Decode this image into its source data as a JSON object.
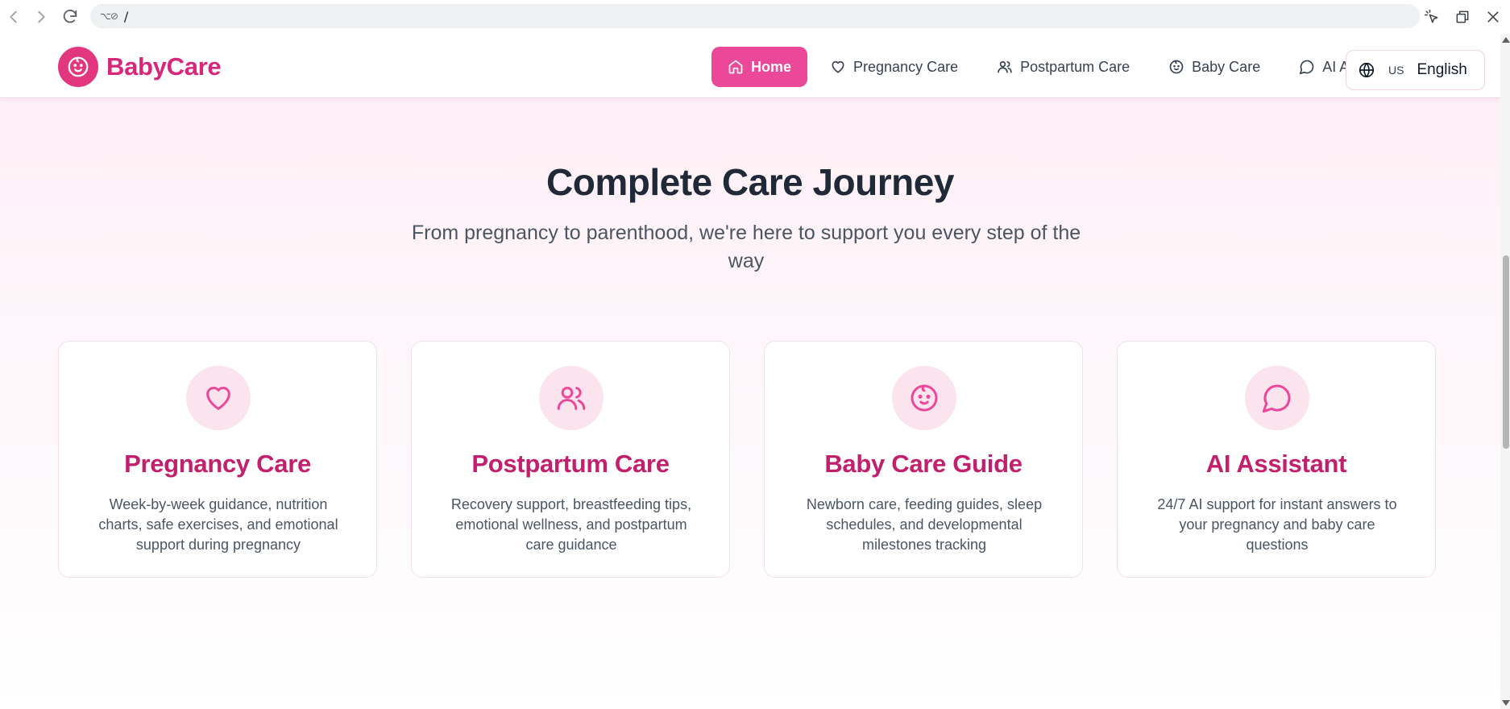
{
  "browser": {
    "url": "/",
    "back_icon": "chevron-left-icon",
    "forward_icon": "chevron-right-icon",
    "reload_icon": "reload-icon"
  },
  "header": {
    "logo_text": "BabyCare",
    "nav": [
      {
        "label": "Home",
        "icon": "home-icon",
        "active": true
      },
      {
        "label": "Pregnancy Care",
        "icon": "heart-icon",
        "active": false
      },
      {
        "label": "Postpartum Care",
        "icon": "users-icon",
        "active": false
      },
      {
        "label": "Baby Care",
        "icon": "baby-icon",
        "active": false
      },
      {
        "label": "AI Assistant",
        "icon": "chat-icon",
        "active": false
      }
    ],
    "language": {
      "flag": "US",
      "label": "English"
    }
  },
  "hero": {
    "title": "Complete Care Journey",
    "subtitle": "From pregnancy to parenthood, we're here to support you every step of the way"
  },
  "features": [
    {
      "title": "Pregnancy Care",
      "icon": "heart-icon",
      "description": "Week-by-week guidance, nutrition charts, safe exercises, and emotional support during pregnancy"
    },
    {
      "title": "Postpartum Care",
      "icon": "users-icon",
      "description": "Recovery support, breastfeeding tips, emotional wellness, and postpartum care guidance"
    },
    {
      "title": "Baby Care Guide",
      "icon": "baby-icon",
      "description": "Newborn care, feeding guides, sleep schedules, and developmental milestones tracking"
    },
    {
      "title": "AI Assistant",
      "icon": "chat-icon",
      "description": "24/7 AI support for instant answers to your pregnancy and baby care questions"
    }
  ],
  "colors": {
    "brand": "#ec4899",
    "brand_dark": "#c21f6c",
    "icon_bg": "#fce4ef"
  }
}
